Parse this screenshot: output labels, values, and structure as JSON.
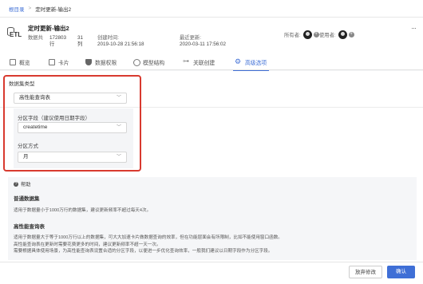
{
  "breadcrumb": {
    "root": "根目录",
    "separator": ">",
    "current": "定时更新-输出2"
  },
  "dataset": {
    "title": "定时更新-输出2",
    "rows_label": "数据共",
    "rows_value": "172803",
    "rows_unit": "行",
    "cols_value": "31",
    "cols_unit": "列",
    "created_label": "创建时间:",
    "created_value": "2019-10-28 21:56:18",
    "updated_label": "最近更新:",
    "updated_value": "2020-03-11 17:56:02",
    "owner_label": "所有者:",
    "user_label": "使用者:"
  },
  "tabs": [
    {
      "label": "概览",
      "icon": "overview-icon"
    },
    {
      "label": "卡片",
      "icon": "card-icon"
    },
    {
      "label": "数据权限",
      "icon": "shield-icon"
    },
    {
      "label": "模型结构",
      "icon": "model-icon"
    },
    {
      "label": "关联创建",
      "icon": "link-icon"
    },
    {
      "label": "高级选项",
      "icon": "gear-icon"
    }
  ],
  "form": {
    "dataset_type_label": "数据集类型",
    "dataset_type_value": "高性能查询表",
    "partition_field_label": "分区字段（建议使用日期字段）",
    "partition_field_value": "createtime",
    "partition_method_label": "分区方式",
    "partition_method_value": "月"
  },
  "help": {
    "title": "帮助",
    "section1_head": "普通数据集",
    "section1_text": "适用于数据量小于1000万行的数据集，建议更新频率不超过每天4次。",
    "section2_head": "高性能查询表",
    "section2_line1": "适用于数据量大于等于1000万行以上的数据集，可大大加速卡片做数据查询的效率，但在功能层面会有所限制，比如不能使用窗口函数。",
    "section2_line2": "高性能查询表在更新时需要花费更多的时间，建议更新频率不超一天一次。",
    "section2_line3": "需要根据具体使用场景，为高性能查询表设置合适的分区字段，以便进一步优化查询效率，一般我们建议以日期字段作为分区字段。"
  },
  "footer": {
    "cancel_label": "放弃修改",
    "ok_label": "确认"
  },
  "colors": {
    "accent": "#3f6fd6",
    "highlight_box": "#d83a2f"
  }
}
